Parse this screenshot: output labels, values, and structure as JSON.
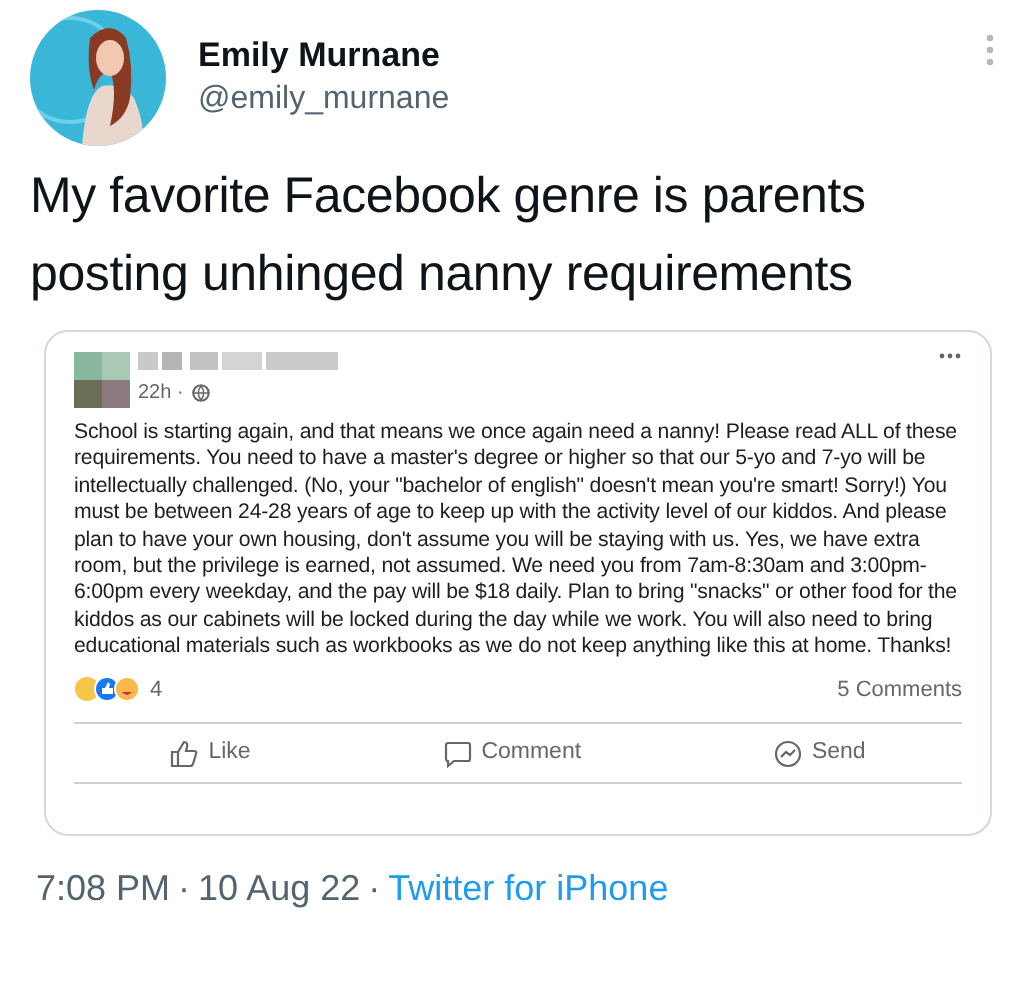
{
  "tweet": {
    "author_name": "Emily Murnane",
    "handle": "@emily_murnane",
    "text": "My favorite Facebook genre is parents posting unhinged nanny requirements"
  },
  "embedded_post": {
    "time": "22h ·",
    "text": "School is starting again, and that means we once again need a nanny! Please read ALL of these requirements. You need to have a master's degree or higher so that our 5-yo and 7-yo will be intellectually challenged. (No, your \"bachelor of english\" doesn't mean you're smart! Sorry!) You must be between 24-28 years of age to keep up with the activity level of our kiddos. And please plan to have your own housing, don't assume you will be staying with us. Yes, we have extra room, but the privilege is earned, not assumed. We need you from 7am-8:30am and 3:00pm-6:00pm every weekday, and the pay will be $18 daily. Plan to bring \"snacks\" or other food for the kiddos as our cabinets will be locked during the day while we work. You will also need to bring educational materials such as workbooks as we do not keep anything like this at home. Thanks!",
    "reaction_count": "4",
    "comments_count": "5 Comments",
    "actions": [
      {
        "kind": "like",
        "label": "Like"
      },
      {
        "kind": "comment",
        "label": "Comment"
      },
      {
        "kind": "send",
        "label": "Send"
      }
    ]
  },
  "footer": [
    {
      "kind": "meta",
      "text": "7:08 PM"
    },
    {
      "kind": "meta",
      "text": "·"
    },
    {
      "kind": "meta",
      "text": "10 Aug 22"
    },
    {
      "kind": "meta",
      "text": "·"
    },
    {
      "kind": "link",
      "text": "Twitter for iPhone"
    }
  ]
}
